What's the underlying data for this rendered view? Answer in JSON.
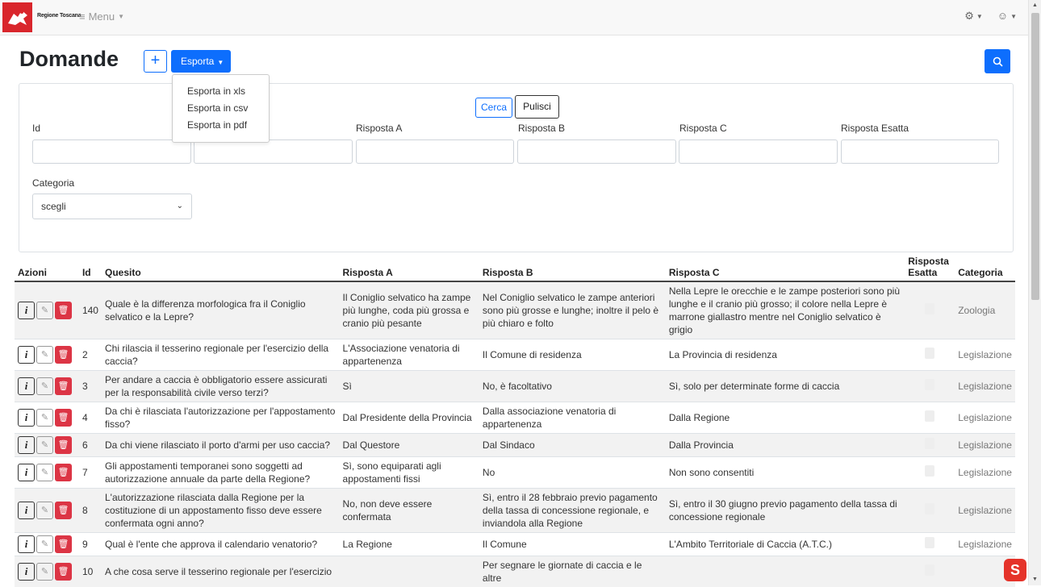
{
  "app": {
    "brand": "Regione Toscana",
    "menu_label": "Menu"
  },
  "page": {
    "title": "Domande",
    "add_label": "+",
    "export_label": "Esporta"
  },
  "export_menu": [
    "Esporta in xls",
    "Esporta in csv",
    "Esporta in pdf"
  ],
  "filter": {
    "search_label": "Cerca",
    "clear_label": "Pulisci",
    "fields": [
      "Id",
      "",
      "Risposta A",
      "Risposta B",
      "Risposta C",
      "Risposta Esatta"
    ],
    "category_label": "Categoria",
    "category_value": "scegli"
  },
  "table": {
    "headers": [
      "Azioni",
      "Id",
      "Quesito",
      "Risposta A",
      "Risposta B",
      "Risposta C",
      "Risposta Esatta",
      "Categoria"
    ],
    "rows": [
      {
        "id": "140",
        "q": "Quale è la differenza morfologica fra il Coniglio selvatico e la Lepre?",
        "a": "Il Coniglio selvatico ha zampe più lunghe, coda più grossa e cranio più pesante",
        "b": "Nel Coniglio selvatico le zampe anteriori sono più grosse e lunghe; inoltre il pelo è più chiaro e folto",
        "c": "Nella Lepre le orecchie e le zampe posteriori sono più lunghe e il cranio più grosso; il colore nella Lepre è marrone giallastro mentre nel Coniglio selvatico è grigio",
        "cat": "Zoologia"
      },
      {
        "id": "2",
        "q": "Chi rilascia il tesserino regionale per l'esercizio della caccia?",
        "a": "L'Associazione venatoria di appartenenza",
        "b": "Il Comune di residenza",
        "c": "La Provincia di residenza",
        "cat": "Legislazione"
      },
      {
        "id": "3",
        "q": "Per andare a caccia è obbligatorio essere assicurati per la responsabilità civile verso terzi?",
        "a": "Sì",
        "b": "No, è facoltativo",
        "c": "Sì, solo per determinate forme di caccia",
        "cat": "Legislazione"
      },
      {
        "id": "4",
        "q": "Da chi è rilasciata l'autorizzazione per l'appostamento fisso?",
        "a": "Dal Presidente della Provincia",
        "b": "Dalla associazione venatoria di appartenenza",
        "c": "Dalla Regione",
        "cat": "Legislazione"
      },
      {
        "id": "6",
        "q": "Da chi viene rilasciato il porto d'armi per uso caccia?",
        "a": "Dal Questore",
        "b": "Dal Sindaco",
        "c": "Dalla Provincia",
        "cat": "Legislazione"
      },
      {
        "id": "7",
        "q": "Gli appostamenti temporanei sono soggetti ad autorizzazione annuale da parte della Regione?",
        "a": "Sì, sono equiparati agli appostamenti fissi",
        "b": "No",
        "c": "Non sono consentiti",
        "cat": "Legislazione"
      },
      {
        "id": "8",
        "q": "L'autorizzazione rilasciata dalla Regione per la costituzione di un appostamento fisso deve essere confermata ogni anno?",
        "a": "No, non deve essere confermata",
        "b": "Sì, entro il 28 febbraio previo pagamento della tassa di concessione regionale, e inviandola alla Regione",
        "c": "Sì, entro il 30 giugno previo pagamento della tassa di concessione regionale",
        "cat": "Legislazione"
      },
      {
        "id": "9",
        "q": "Qual è l'ente che approva il calendario venatorio?",
        "a": "La Regione",
        "b": "Il Comune",
        "c": "L'Ambito Territoriale di Caccia (A.T.C.)",
        "cat": "Legislazione"
      },
      {
        "id": "10",
        "q": "A che cosa serve il tesserino regionale per l'esercizio",
        "a": "",
        "b": "Per segnare le giornate di caccia e le altre",
        "c": "",
        "cat": ""
      }
    ]
  },
  "colors": {
    "primary": "#0d6efd",
    "danger": "#dc3545",
    "logo_red": "#d9262c"
  }
}
